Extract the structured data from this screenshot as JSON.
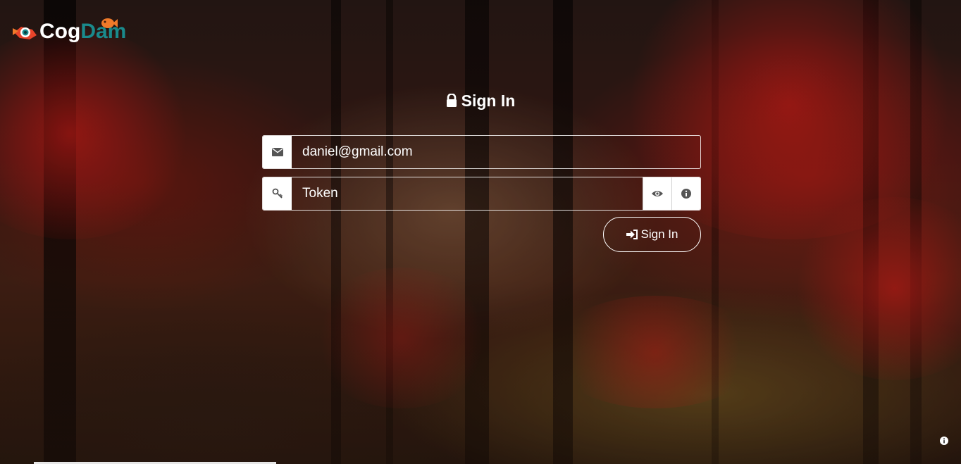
{
  "brand": {
    "name_part1": "Cog",
    "name_part2": "Dam",
    "color_part2": "#1a8a8c",
    "logo_icon": "fish-logo-icon"
  },
  "signin": {
    "title": "Sign In",
    "title_icon": "lock-icon"
  },
  "form": {
    "email": {
      "icon": "envelope-icon",
      "value": "daniel@gmail.com"
    },
    "token": {
      "icon": "key-icon",
      "value": "Token",
      "show_icon": "eye-icon",
      "info_icon": "info-icon"
    },
    "submit_label": "Sign In",
    "submit_icon": "sign-in-icon"
  },
  "footer": {
    "info_icon": "info-icon"
  }
}
